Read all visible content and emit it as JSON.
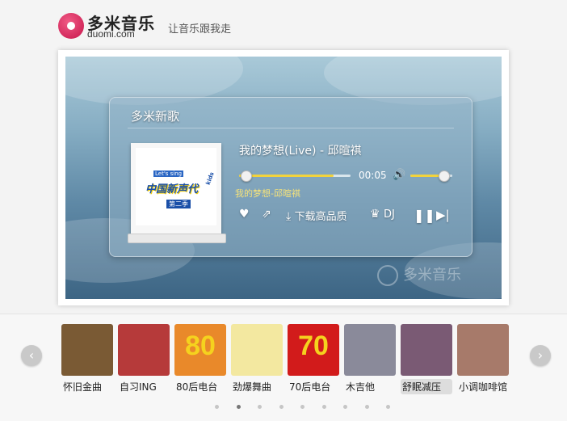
{
  "header": {
    "logo_cn": "多米音乐",
    "logo_en": "duomi.com",
    "slogan": "让音乐跟我走"
  },
  "player": {
    "title": "多米新歌",
    "song": "我的梦想(Live) - 邱暄祺",
    "time": "00:05",
    "lyric": "我的梦想-邱暄祺",
    "progress_fraction": 0.85,
    "volume_fraction": 0.78,
    "download_label": "下载高品质",
    "dj_label": "DJ",
    "cover": {
      "main_text": "中国新声代",
      "top_text": "Let's sing",
      "sub_text": "第二季",
      "side_text": "kids"
    },
    "watermark": "多米音乐"
  },
  "channels": [
    {
      "label": "怀旧金曲",
      "color": "#7a5a34"
    },
    {
      "label": "自习ING",
      "color": "#b63a3a"
    },
    {
      "label": "80后电台",
      "color": "#e9892a"
    },
    {
      "label": "劲爆舞曲",
      "color": "#f3e8a0"
    },
    {
      "label": "70后电台",
      "color": "#d21b1b"
    },
    {
      "label": "木吉他",
      "color": "#8a8a9a"
    },
    {
      "label": "舒眠减压",
      "color": "#7a5a74"
    },
    {
      "label": "小调咖啡馆",
      "color": "#a77a6a"
    }
  ],
  "channel_badges": {
    "c2": "80",
    "c4": "70"
  },
  "pager": {
    "count": 9,
    "active_index": 1
  },
  "colors": {
    "accent": "#f2d33c",
    "brand": "#c7154b"
  }
}
